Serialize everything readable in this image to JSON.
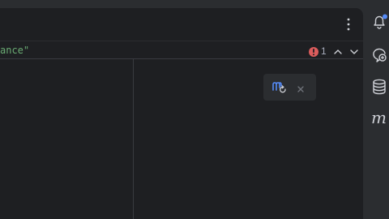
{
  "editor": {
    "code_fragment": "ance\"",
    "inspection": {
      "error_count": "1"
    }
  },
  "maven_popup": {
    "icon": "maven-reload-icon",
    "close_icon": "close-icon"
  },
  "right_toolbar": {
    "items": [
      {
        "icon": "notifications-bell-icon"
      },
      {
        "icon": "ai-assistant-icon"
      },
      {
        "icon": "database-icon"
      },
      {
        "icon": "maven-icon",
        "label": "m"
      }
    ]
  },
  "colors": {
    "editor_bg": "#1e1f22",
    "chrome_bg": "#2b2d30",
    "string_green": "#6aab73",
    "error_red": "#db5c5c",
    "notification_dot": "#548af7",
    "maven_blue": "#548af7"
  }
}
